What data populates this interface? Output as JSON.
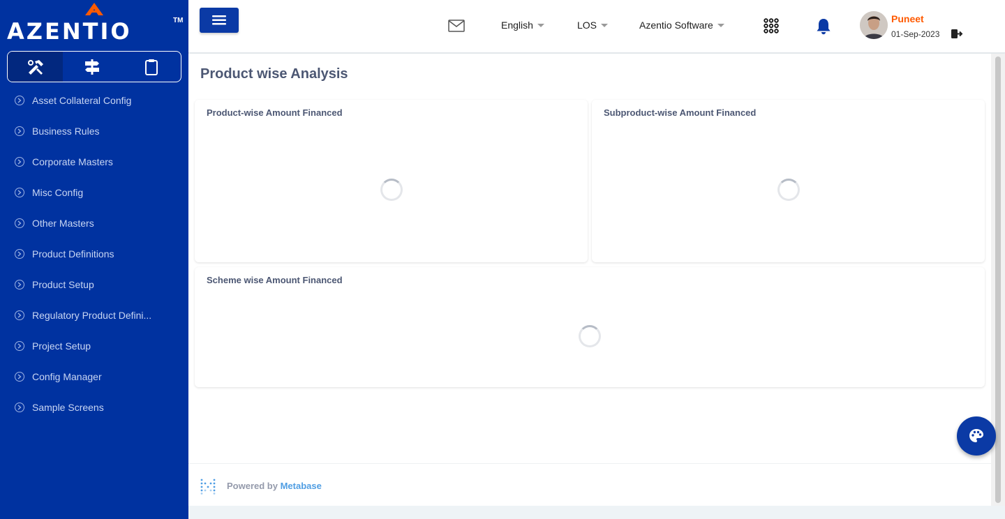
{
  "brand": {
    "logo_text": "AZENTIO",
    "trademark": "TM",
    "accent_color": "#ff5a00",
    "primary_color": "#0032a0"
  },
  "sidebar": {
    "tool_tabs": [
      {
        "icon": "tools-icon",
        "active": true
      },
      {
        "icon": "signpost-icon",
        "active": false
      },
      {
        "icon": "clipboard-icon",
        "active": false
      }
    ],
    "items": [
      {
        "label": "Asset Collateral Config"
      },
      {
        "label": "Business Rules"
      },
      {
        "label": "Corporate Masters"
      },
      {
        "label": "Misc Config"
      },
      {
        "label": "Other Masters"
      },
      {
        "label": "Product Definitions"
      },
      {
        "label": "Product Setup"
      },
      {
        "label": "Regulatory Product Defini..."
      },
      {
        "label": "Project Setup"
      },
      {
        "label": "Config Manager"
      },
      {
        "label": "Sample Screens"
      }
    ]
  },
  "header": {
    "language": "English",
    "module": "LOS",
    "organization": "Azentio Software",
    "user": {
      "name": "Puneet",
      "date": "01-Sep-2023"
    }
  },
  "main": {
    "title": "Product wise Analysis",
    "cards": [
      {
        "title": "Product-wise Amount Financed",
        "state": "loading"
      },
      {
        "title": "Subproduct-wise Amount Financed",
        "state": "loading"
      },
      {
        "title": "Scheme wise Amount Financed",
        "state": "loading"
      }
    ],
    "footer": {
      "powered_by": "Powered by",
      "vendor": "Metabase"
    }
  }
}
